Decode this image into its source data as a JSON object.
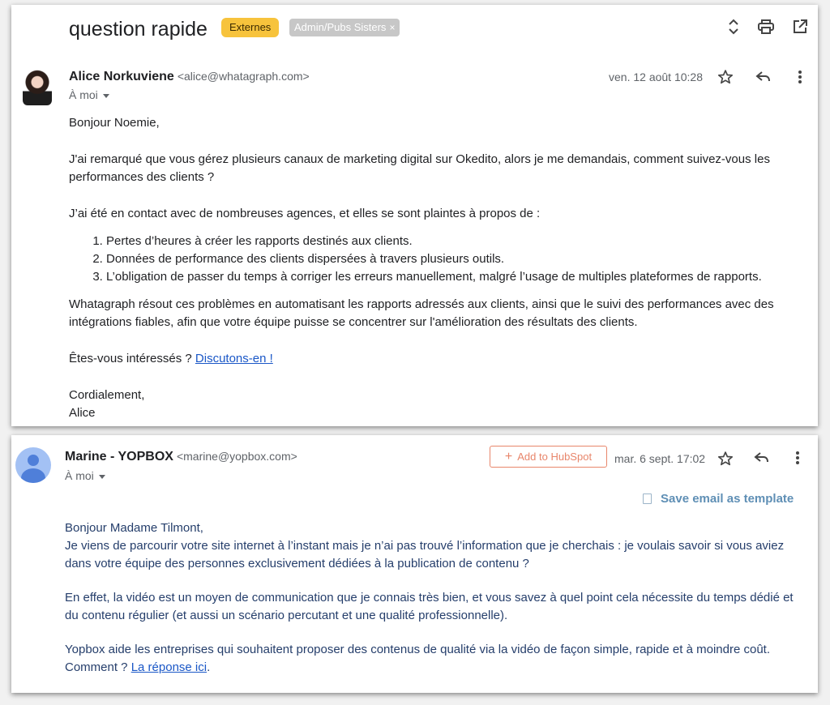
{
  "thread": {
    "subject": "question rapide",
    "labels": [
      {
        "text": "Externes",
        "color": "#f7c33c"
      },
      {
        "text": "Admin/Pubs Sisters",
        "color": "#c7c7c7"
      }
    ],
    "label_remove": "×"
  },
  "message1": {
    "sender_name": "Alice Norkuviene",
    "sender_email": "<alice@whatagraph.com>",
    "to": "À moi",
    "date": "ven. 12 août 10:28",
    "greeting": "Bonjour Noemie,",
    "para1": "J'ai remarqué que vous gérez plusieurs canaux de marketing digital sur Okedito, alors je me demandais, comment suivez-vous les performances des clients ?",
    "para2": "J’ai été en contact avec de nombreuses agences, et elles se sont plaintes à propos de :",
    "list": [
      "Pertes d’heures à créer les rapports destinés aux clients.",
      "Données de performance des clients dispersées à travers plusieurs outils.",
      "L’obligation de passer du temps à corriger les erreurs manuellement, malgré l’usage de multiples plateformes de rapports."
    ],
    "para3": "Whatagraph résout ces problèmes en automatisant les rapports adressés aux clients, ainsi que le suivi des performances avec des intégrations fiables, afin que votre équipe puisse se concentrer sur l'amélioration des résultats des clients.",
    "question": "Êtes-vous intéressés ? ",
    "link": "Discutons-en !",
    "closing": "Cordialement,",
    "signature": "Alice"
  },
  "message2": {
    "sender_name": "Marine - YOPBOX",
    "sender_email": "<marine@yopbox.com>",
    "to": "À moi",
    "hubspot_button": "Add to HubSpot",
    "date": "mar. 6 sept. 17:02",
    "save_template": "Save email as template",
    "greeting": "Bonjour Madame Tilmont,",
    "line1": "Je viens de parcourir votre site internet à l’instant mais je n’ai pas trouvé l’information que je cherchais : je voulais savoir si vous aviez dans votre équipe des personnes exclusivement dédiées à la publication de contenu ?",
    "para2": "En effet, la vidéo est un moyen de communication que je connais très bien, et vous savez à quel point cela nécessite du temps dédié et du contenu régulier (et aussi un scénario percutant et une qualité professionnelle).",
    "para3": "Yopbox aide les entreprises qui souhaitent proposer des contenus de qualité via la vidéo de façon simple, rapide et à moindre coût.",
    "question": "Comment ? ",
    "link": "La réponse ici",
    "question_end": "."
  },
  "icons": {
    "expand": "unfold-icon",
    "print": "print-icon",
    "open": "open-in-new-icon",
    "star": "star-icon",
    "reply": "reply-icon",
    "more": "more-vert-icon"
  }
}
